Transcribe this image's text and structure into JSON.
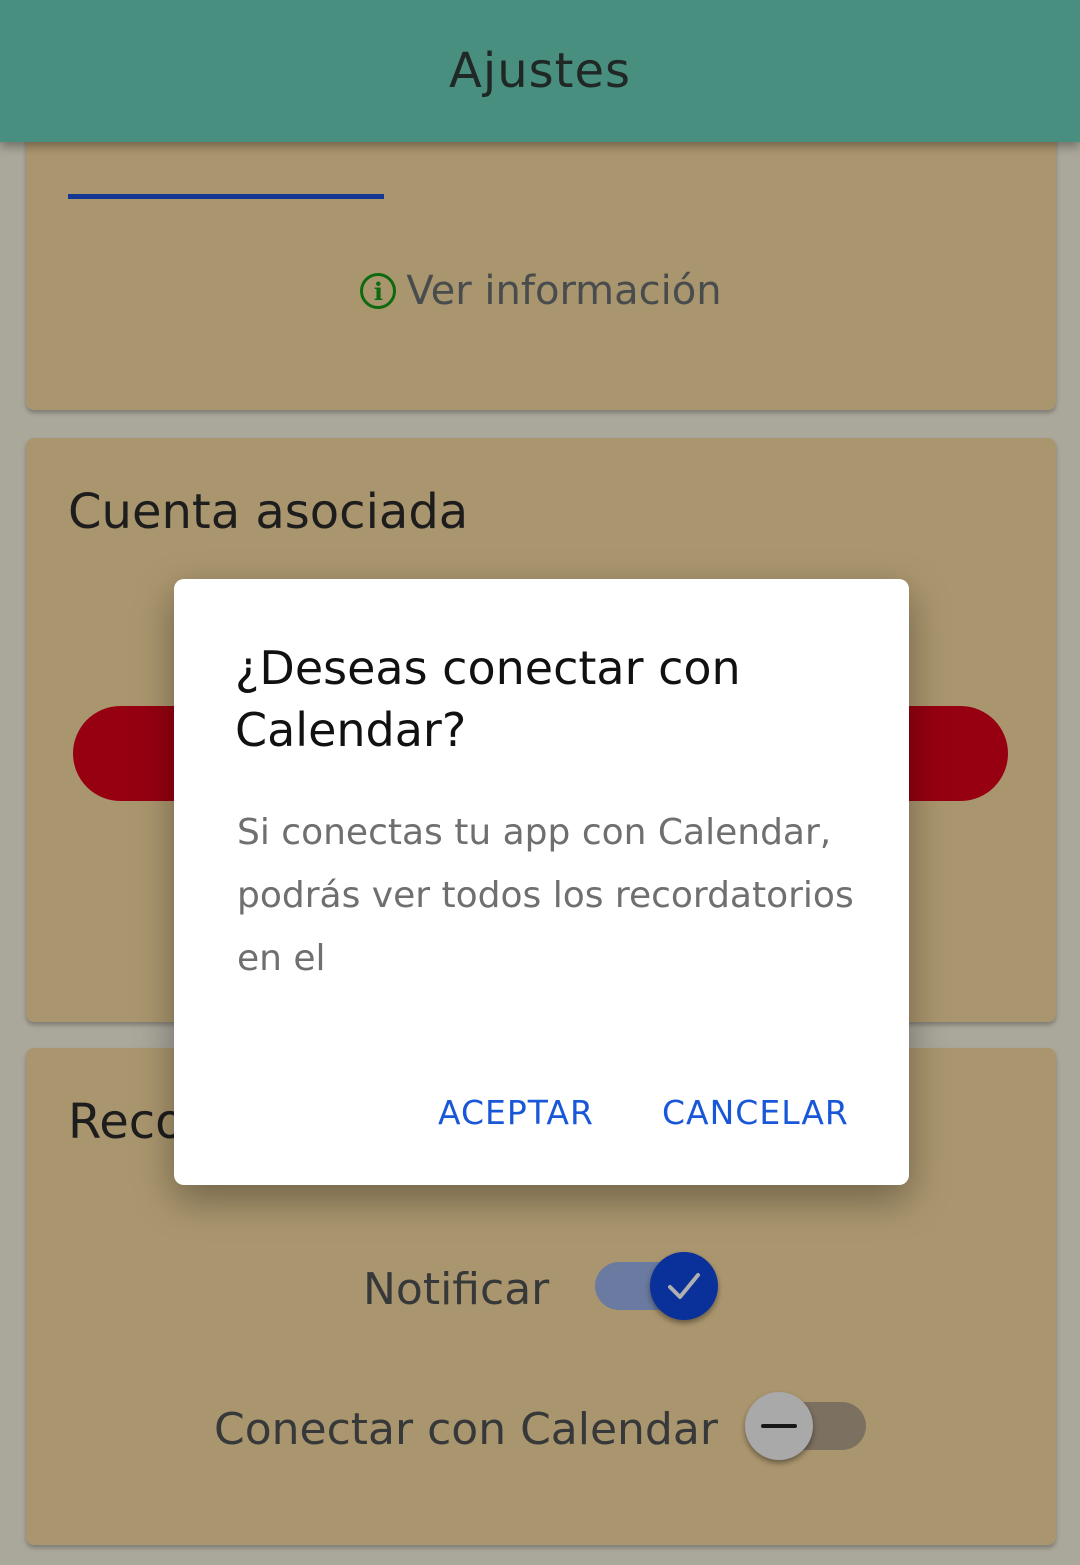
{
  "header": {
    "title": "Ajustes"
  },
  "card1": {
    "info_label": "Ver información",
    "info_icon": "info-circle-icon"
  },
  "card2": {
    "title": "Cuenta asociada"
  },
  "card3": {
    "title": "Reco",
    "notify_label": "Notificar",
    "notify_on": true,
    "calendar_label": "Conectar con Calendar",
    "calendar_on": false
  },
  "dialog": {
    "title": "¿Deseas conectar con Calendar?",
    "body": "Si conectas tu app con Calendar, podrás ver todos los recordatorios en el",
    "accept_label": "ACEPTAR",
    "cancel_label": "CANCELAR"
  },
  "colors": {
    "header": "#6bcfb8",
    "card": "#f7d9a0",
    "accent_blue": "#1f4fd6",
    "danger_red": "#d9001a",
    "info_green": "#159a18",
    "dialog_button": "#1857d8"
  }
}
